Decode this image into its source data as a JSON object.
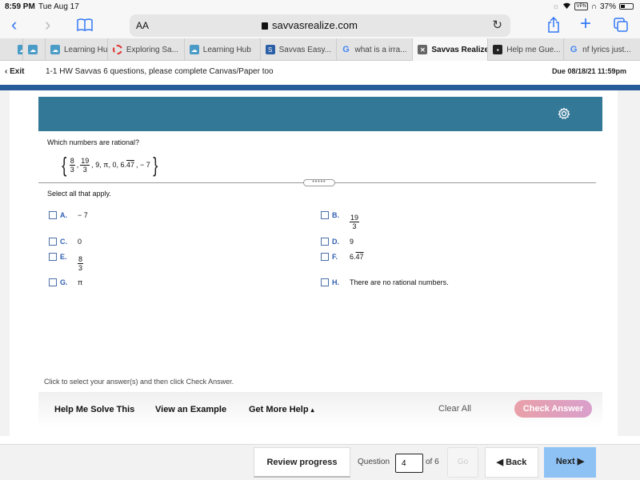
{
  "status_bar": {
    "time": "8:59 PM",
    "date": "Tue Aug 17",
    "vpn": "VPN",
    "battery": "37%"
  },
  "browser": {
    "text_size_label": "AA",
    "url": "savvasrealize.com",
    "icons": [
      "back-icon",
      "forward-icon",
      "bookmarks-icon",
      "lock-icon",
      "reload-icon",
      "share-icon",
      "new-tab-icon",
      "tabs-icon"
    ]
  },
  "tabs": [
    {
      "label": "",
      "icon": "cloud",
      "active": false
    },
    {
      "label": "",
      "icon": "cloud",
      "active": false
    },
    {
      "label": "Learning Hu",
      "icon": "cloud",
      "active": false
    },
    {
      "label": "Exploring Sa...",
      "icon": "red",
      "active": false
    },
    {
      "label": "Learning Hub",
      "icon": "cloud",
      "active": false
    },
    {
      "label": "Savvas Easy...",
      "icon": "sav",
      "active": false
    },
    {
      "label": "what is a irra...",
      "icon": "google",
      "active": false
    },
    {
      "label": "Savvas Realize",
      "icon": "xbox",
      "active": true
    },
    {
      "label": "Help me Gue...",
      "icon": "dark",
      "active": false
    },
    {
      "label": "nf lyrics just...",
      "icon": "google",
      "active": false
    }
  ],
  "app_header": {
    "exit_label": "Exit",
    "assignment_title": "1-1 HW Savvas 6 questions, please complete Canvas/Paper too",
    "due": "Due 08/18/21 11:59pm"
  },
  "question": {
    "prompt": "Which numbers are rational?",
    "set": {
      "f1_num": "8",
      "f1_den": "3",
      "f2_num": "19",
      "f2_den": "3",
      "rest1": ", 9, π, 0, 6.",
      "repeating": "47",
      "rest2": ",  − 7"
    },
    "divider_handle": "•••••",
    "instruction": "Select all that apply.",
    "choices": [
      {
        "letter": "A.",
        "value": "− 7"
      },
      {
        "letter": "B.",
        "num": "19",
        "den": "3"
      },
      {
        "letter": "C.",
        "value": "0"
      },
      {
        "letter": "D.",
        "value": "9"
      },
      {
        "letter": "E.",
        "num": "8",
        "den": "3"
      },
      {
        "letter": "F.",
        "value_prefix": "6.",
        "value_repeat": "47"
      },
      {
        "letter": "G.",
        "value": "π"
      },
      {
        "letter": "H.",
        "value": "There are no rational numbers."
      }
    ]
  },
  "hint": "Click to select your answer(s) and then click Check Answer.",
  "help_bar": {
    "help_me_solve": "Help Me Solve This",
    "view_example": "View an Example",
    "get_more_help": "Get More Help",
    "get_more_help_arrow": "▴",
    "clear_all": "Clear All",
    "check_answer": "Check Answer"
  },
  "footer": {
    "review_progress": "Review progress",
    "question_label": "Question",
    "question_value": "4",
    "of_label": "of 6",
    "go_label": "Go",
    "back_label": "Back",
    "back_arrow": "🡐",
    "next_label": "Next",
    "next_arrow": "🡒"
  },
  "colors": {
    "question_header": "#347897",
    "brand_bar": "#275b99",
    "next_button": "#8ec2f5",
    "check_answer": "#e9a0a8"
  }
}
